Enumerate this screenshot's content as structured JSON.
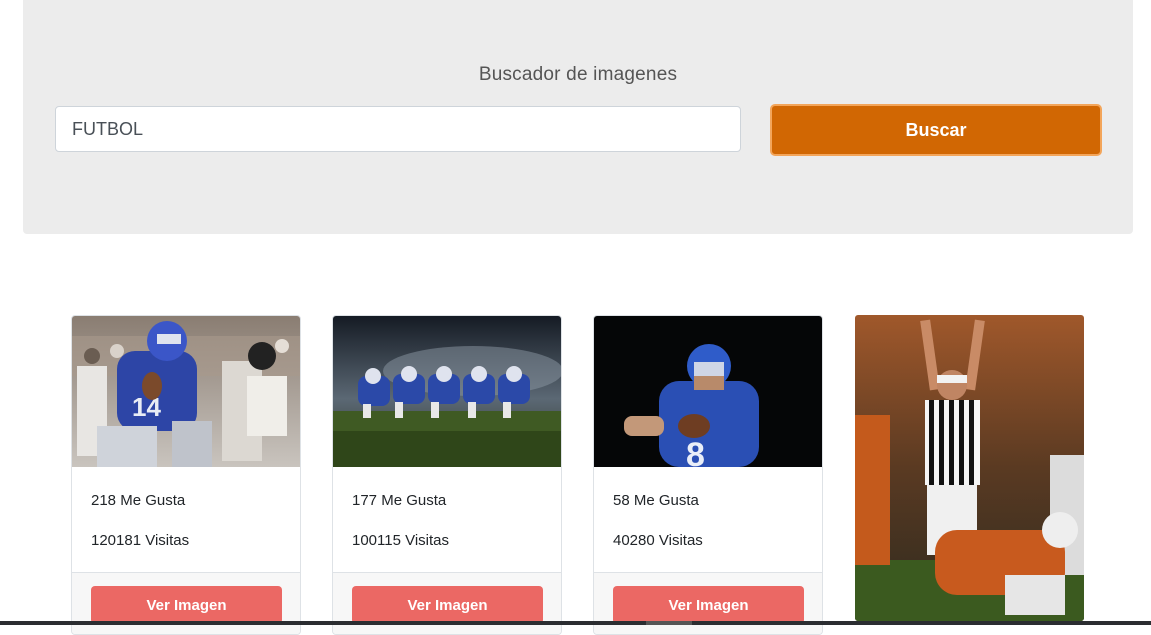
{
  "header": {
    "title": "Buscador de imagenes"
  },
  "search": {
    "value": "FUTBOL",
    "button_label": "Buscar"
  },
  "colors": {
    "accent": "#d16703",
    "view_button": "#eb6864",
    "panel": "#ececec"
  },
  "results": [
    {
      "likes": "218 Me Gusta",
      "views": "120181 Visitas",
      "button_label": "Ver Imagen",
      "image": "football-quarterback-photo"
    },
    {
      "likes": "177 Me Gusta",
      "views": "100115 Visitas",
      "button_label": "Ver Imagen",
      "image": "football-lineup-field-photo"
    },
    {
      "likes": "58 Me Gusta",
      "views": "40280 Visitas",
      "button_label": "Ver Imagen",
      "image": "football-player-dark-photo"
    },
    {
      "image": "football-referee-touchdown-photo"
    }
  ]
}
